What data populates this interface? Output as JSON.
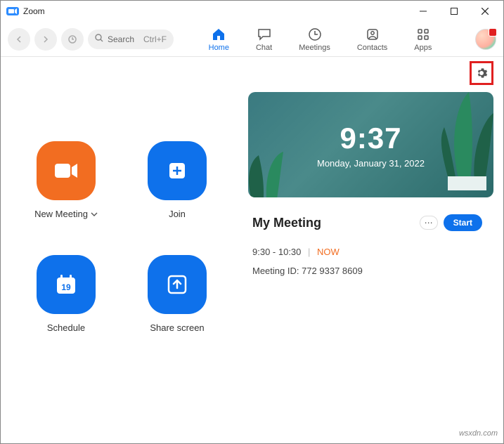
{
  "window": {
    "title": "Zoom"
  },
  "toolbar": {
    "search_label": "Search",
    "search_shortcut": "Ctrl+F"
  },
  "tabs": {
    "home": "Home",
    "chat": "Chat",
    "meetings": "Meetings",
    "contacts": "Contacts",
    "apps": "Apps"
  },
  "actions": {
    "new_meeting": "New Meeting",
    "join": "Join",
    "schedule": "Schedule",
    "schedule_day": "19",
    "share_screen": "Share screen"
  },
  "clock": {
    "time": "9:37",
    "date": "Monday, January 31, 2022"
  },
  "meeting": {
    "title": "My Meeting",
    "time_range": "9:30 - 10:30",
    "separator": "|",
    "now_label": "NOW",
    "id_label": "Meeting ID: 772 9337 8609",
    "start_label": "Start"
  },
  "credit": "wsxdn.com"
}
